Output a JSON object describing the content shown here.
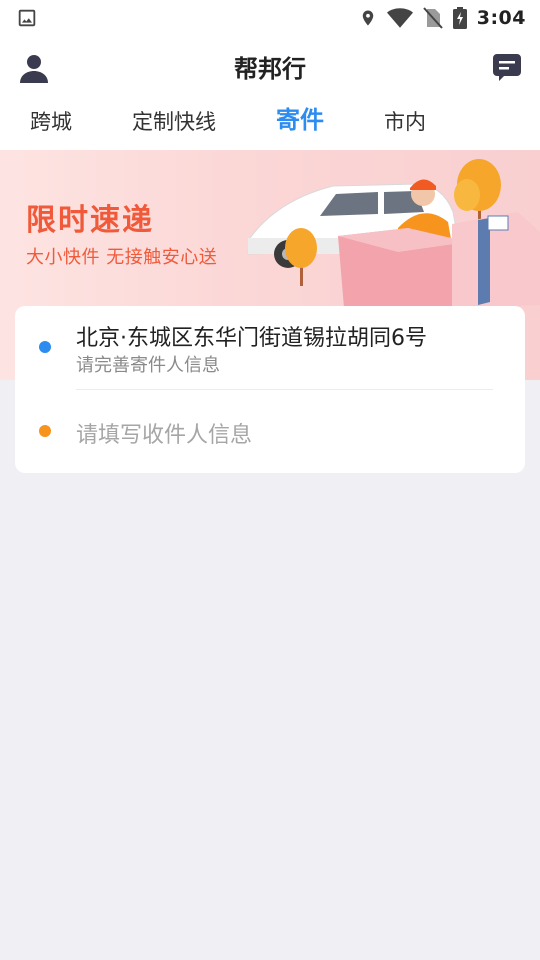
{
  "status_bar": {
    "time": "3:04",
    "icons": [
      "image-icon",
      "location-icon",
      "wifi-icon",
      "no-sim-icon",
      "battery-charging-icon"
    ]
  },
  "header": {
    "title": "帮邦行",
    "left_icon": "user-icon",
    "right_icon": "message-icon"
  },
  "tabs": [
    {
      "label": "跨城",
      "active": false
    },
    {
      "label": "定制快线",
      "active": false
    },
    {
      "label": "寄件",
      "active": true
    },
    {
      "label": "市内",
      "active": false
    }
  ],
  "banner": {
    "title": "限时速递",
    "subtitle": "大小快件 无接触安心送"
  },
  "address_card": {
    "sender": {
      "address": "北京·东城区东华门街道锡拉胡同6号",
      "hint": "请完善寄件人信息"
    },
    "receiver": {
      "placeholder": "请填写收件人信息"
    }
  },
  "colors": {
    "accent": "#2d8cf0",
    "sender_dot": "#2d8cf0",
    "receiver_dot": "#f7941d",
    "banner_text": "#f05a3a",
    "page_background": "#efeff4"
  }
}
